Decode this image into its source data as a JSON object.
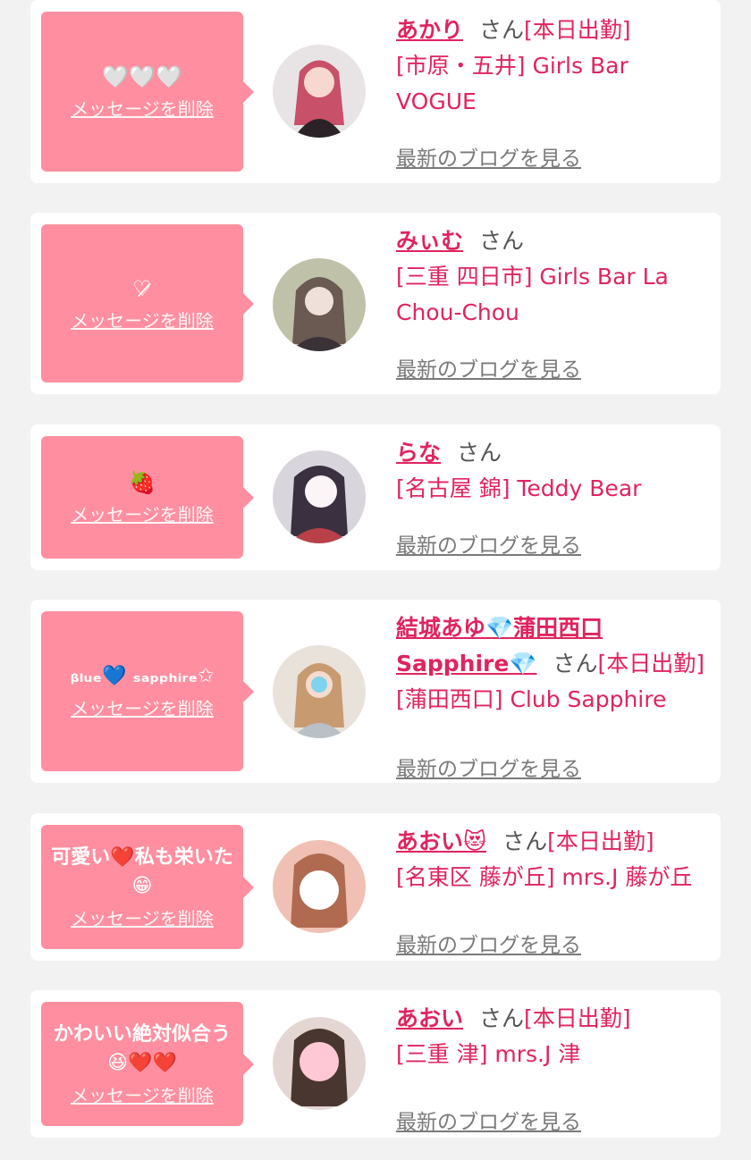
{
  "delete_label": "メッセージを削除",
  "san_label": "さん",
  "blog_label": "最新のブログを見る",
  "colors": {
    "background": "#f2f2f2",
    "bubble": "#ff8fa0",
    "name": "#e0245e",
    "muted": "#7a7a7a"
  },
  "messages": [
    {
      "message": "🤍🤍🤍",
      "name": "あかり",
      "working": "[本日出勤]",
      "shop": "[市原・五井] Girls Bar VOGUE"
    },
    {
      "message": "♡̷",
      "name": "みぃむ",
      "working": "",
      "shop": "[三重 四日市] Girls Bar La Chou-Chou"
    },
    {
      "message": "🍓",
      "name": "らな",
      "working": "",
      "shop": "[名古屋 錦] Teddy Bear"
    },
    {
      "message": "ᵦₗᵤₑ💙 ₛₐₚₚₕᵢᵣₑ✩",
      "name": "結城あゆ💎蒲田西口Sapphire💎",
      "working": "[本日出勤]",
      "shop": "[蒲田西口] Club Sapphire"
    },
    {
      "message": "可愛い❤️私も栄いた😁",
      "name": "あおい😻",
      "working": "[本日出勤]",
      "shop": "[名東区 藤が丘] mrs.J 藤が丘"
    },
    {
      "message": "かわいい絶対似合う😆❤️❤️",
      "name": "あおい",
      "working": "[本日出勤]",
      "shop": "[三重 津] mrs.J 津"
    }
  ]
}
